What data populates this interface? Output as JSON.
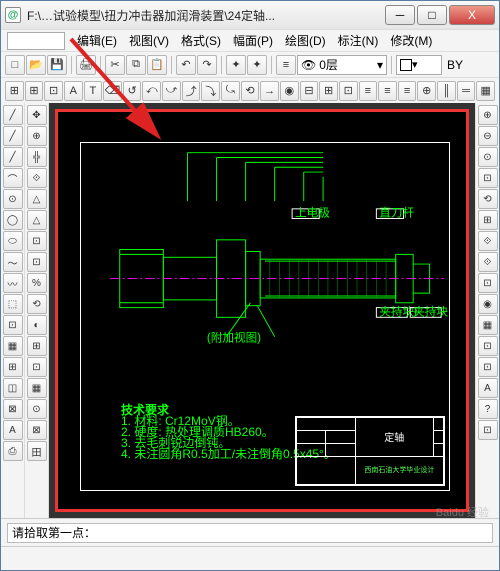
{
  "window": {
    "title": "F:\\…试验模型\\扭力冲击器加润滑装置\\24定轴...",
    "app_icon_glyph": "@"
  },
  "win_controls": {
    "minimize": "─",
    "maximize": "□",
    "close": "X"
  },
  "menu": {
    "edit": "编辑(E)",
    "view": "视图(V)",
    "format": "格式(S)",
    "amplitude": "幅面(P)",
    "draw": "绘图(D)",
    "annotate": "标注(N)",
    "modify": "修改(M)"
  },
  "toolbar1": {
    "new": "□",
    "open": "📂",
    "save": "💾",
    "print": "🖨",
    "cut": "✂",
    "copy": "⧉",
    "paste": "📋",
    "undo": "↶",
    "redo": "↷",
    "feature": "✦",
    "layer_label": "0层",
    "by_label": "BY"
  },
  "toolbar2": {
    "btns": [
      "⊞",
      "⊞",
      "⊡",
      "A",
      "T",
      "⌫",
      "↺",
      "⤺",
      "⤻",
      "⤴",
      "⤵",
      "⤿",
      "⟲",
      "→",
      "◉",
      "⊟",
      "⊞",
      "⊡",
      "≡",
      "≡",
      "≡",
      "⊕",
      "║",
      "═",
      "▦"
    ]
  },
  "left_tools": [
    "╱",
    "╱",
    "╱",
    "⌒",
    "⊙",
    "◯",
    "⬭",
    "～",
    "〰",
    "⬚",
    "⊡",
    "▦",
    "⊞",
    "◫",
    "⊠",
    "A",
    "⎙"
  ],
  "left_tools2": [
    "✥",
    "⊕",
    "╬",
    "⟐",
    "△",
    "△",
    "⊡",
    "⊡",
    "%",
    "⟲",
    "◐",
    "⊞",
    "⊡",
    "▦",
    "⊙",
    "⊠",
    "田"
  ],
  "right_tools": [
    "⊕",
    "⊖",
    "⊙",
    "⊡",
    "⟲",
    "⊞",
    "⟐",
    "⟐",
    "⊡",
    "◉",
    "▦",
    "⊡",
    "⊡",
    "A",
    "?",
    "⊡"
  ],
  "drawing": {
    "notes_title": "技术要求",
    "notes": [
      "1. 材料: Cr12MoV钢。",
      "2. 硬度: 热处理调质HB260。",
      "3. 去毛刺锐边倒钝。",
      "4. 未注圆角R0.5加工/未注倒角0.5x45°。"
    ],
    "label1": "上电极",
    "label2": "直刀杆",
    "label3": "夹持块 I",
    "label4": "夹持块 II",
    "label5": "(附加视图)",
    "titleblock_main": "定轴",
    "titleblock_company": "西南石油大学毕业设计"
  },
  "status": {
    "prompt": "请拾取第一点："
  },
  "watermark": "Baidu 经验"
}
